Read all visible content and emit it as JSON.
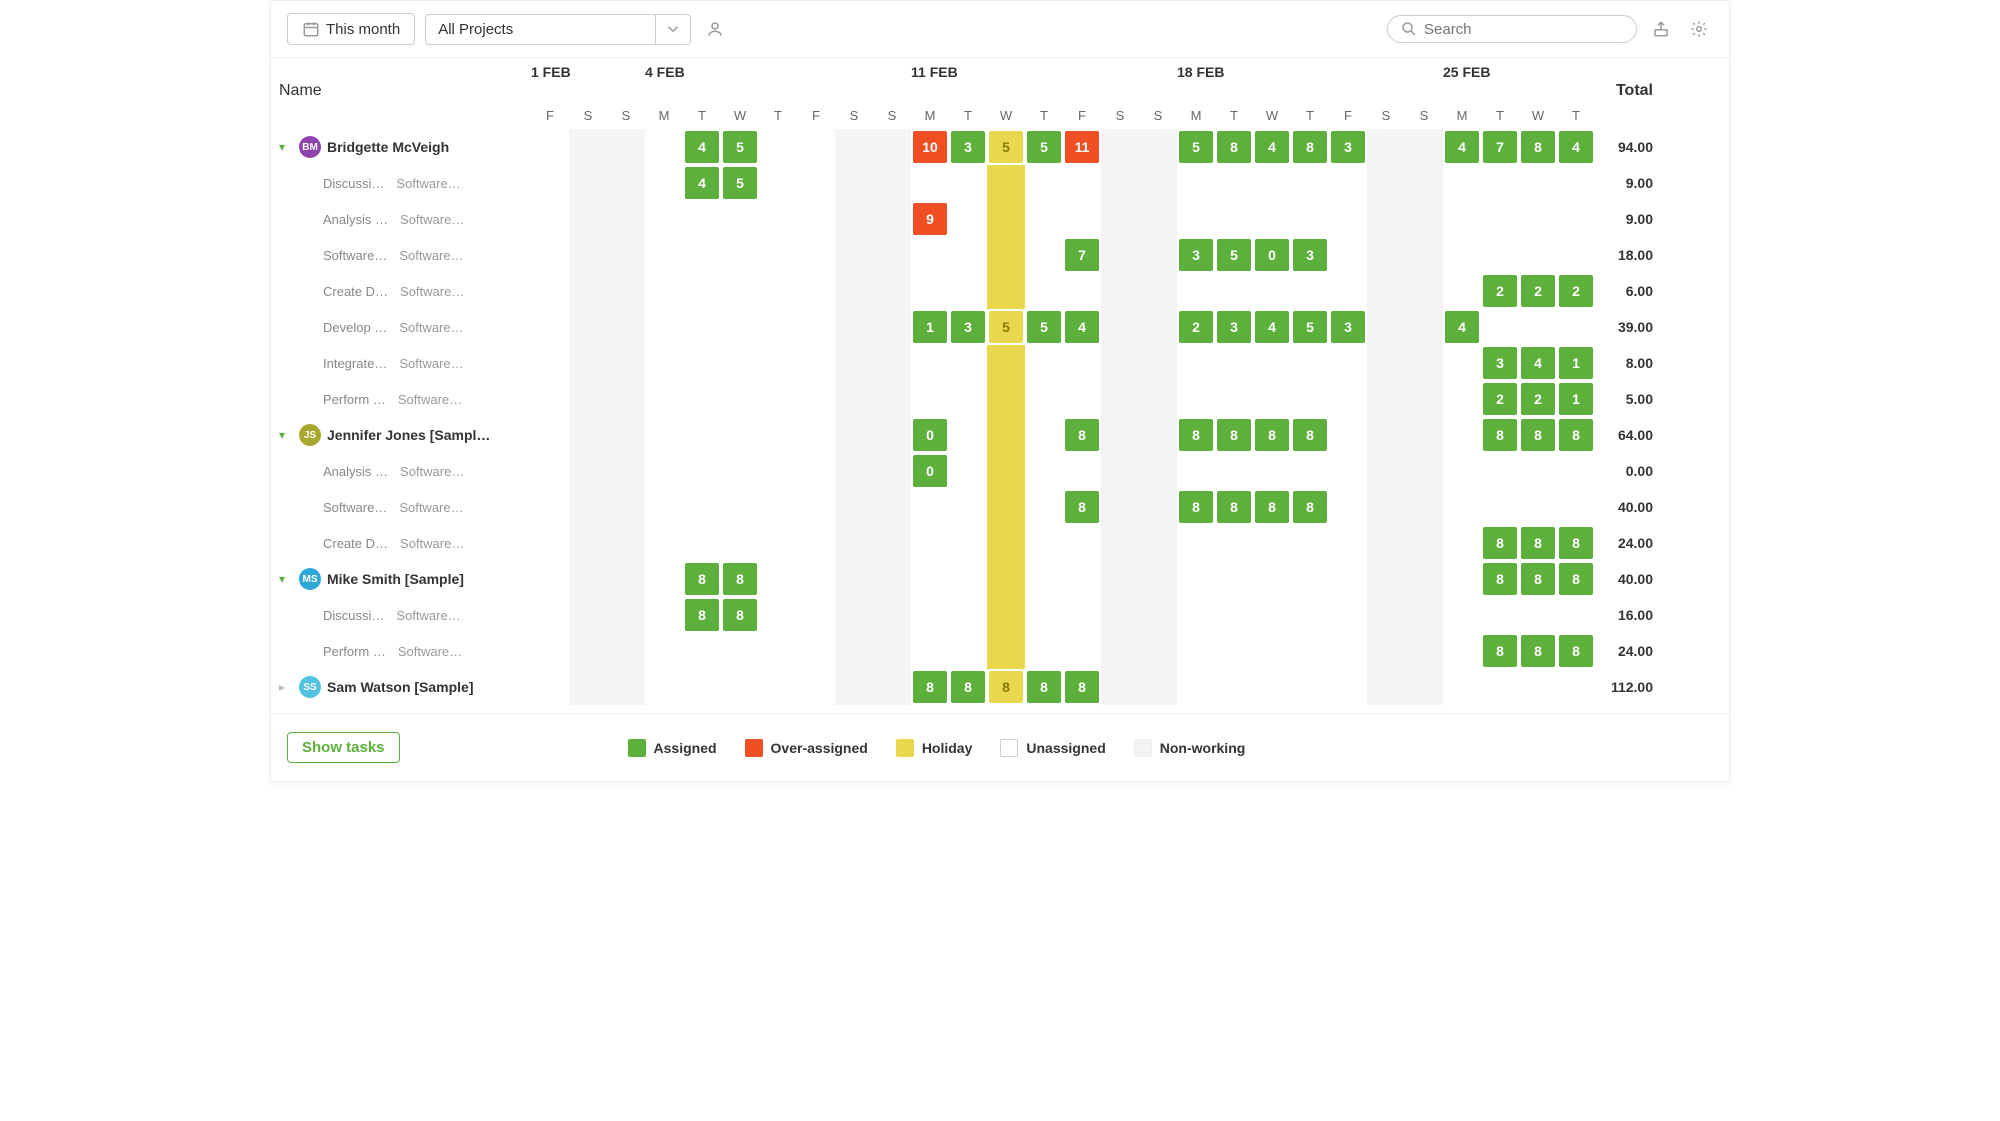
{
  "toolbar": {
    "range_label": "This month",
    "project_filter": "All Projects",
    "search_placeholder": "Search"
  },
  "headers": {
    "name": "Name",
    "total": "Total"
  },
  "columns": [
    {
      "day": "F",
      "month": null,
      "weekend": false
    },
    {
      "day": "S",
      "month": null,
      "weekend": true
    },
    {
      "day": "S",
      "month": null,
      "weekend": true
    },
    {
      "day": "M",
      "month": "1 FEB",
      "weekend": false
    },
    {
      "day": "T",
      "month": null,
      "weekend": false
    },
    {
      "day": "W",
      "month": null,
      "weekend": false
    },
    {
      "day": "T",
      "month": null,
      "weekend": false
    },
    {
      "day": "F",
      "month": null,
      "weekend": false
    },
    {
      "day": "S",
      "month": null,
      "weekend": true
    },
    {
      "day": "S",
      "month": null,
      "weekend": true
    },
    {
      "day": "M",
      "month": "4 FEB",
      "weekend": false
    },
    {
      "day": "T",
      "month": null,
      "weekend": false
    },
    {
      "day": "W",
      "month": "11 FEB",
      "holiday": true
    },
    {
      "day": "T",
      "month": null,
      "weekend": false
    },
    {
      "day": "F",
      "month": null,
      "weekend": false
    },
    {
      "day": "S",
      "month": null,
      "weekend": true
    },
    {
      "day": "S",
      "month": null,
      "weekend": true
    },
    {
      "day": "M",
      "month": null,
      "weekend": false
    },
    {
      "day": "T",
      "month": "18 FEB",
      "weekend": false
    },
    {
      "day": "W",
      "month": null,
      "weekend": false
    },
    {
      "day": "T",
      "month": null,
      "weekend": false
    },
    {
      "day": "F",
      "month": null,
      "weekend": false
    },
    {
      "day": "S",
      "month": null,
      "weekend": true
    },
    {
      "day": "S",
      "month": null,
      "weekend": true
    },
    {
      "day": "M",
      "month": null,
      "weekend": false
    },
    {
      "day": "T",
      "month": "25 FEB",
      "weekend": false
    },
    {
      "day": "W",
      "month": null,
      "weekend": false
    },
    {
      "day": "T",
      "month": null,
      "weekend": false
    }
  ],
  "month_labels": [
    {
      "col": 0,
      "text": "1 FEB"
    },
    {
      "col": 3,
      "text": "4 FEB"
    },
    {
      "col": 10,
      "text": "11 FEB"
    },
    {
      "col": 17,
      "text": "18 FEB"
    },
    {
      "col": 24,
      "text": "25 FEB"
    }
  ],
  "people": [
    {
      "name": "Bridgette McVeigh",
      "initials": "BM",
      "color": "#8e44ad",
      "expanded": true,
      "total": "94.00",
      "cells": {
        "4": {
          "v": "4",
          "t": "a"
        },
        "5": {
          "v": "5",
          "t": "a"
        },
        "10": {
          "v": "10",
          "t": "o"
        },
        "11": {
          "v": "3",
          "t": "a"
        },
        "12": {
          "v": "5",
          "t": "h"
        },
        "13": {
          "v": "5",
          "t": "a"
        },
        "14": {
          "v": "11",
          "t": "o"
        },
        "17": {
          "v": "5",
          "t": "a"
        },
        "18": {
          "v": "8",
          "t": "a"
        },
        "19": {
          "v": "4",
          "t": "a"
        },
        "20": {
          "v": "8",
          "t": "a"
        },
        "21": {
          "v": "3",
          "t": "a"
        },
        "24": {
          "v": "4",
          "t": "a"
        },
        "25": {
          "v": "7",
          "t": "a"
        },
        "26": {
          "v": "8",
          "t": "a"
        },
        "27": {
          "v": "4",
          "t": "a"
        }
      },
      "tasks": [
        {
          "task": "Discussi…",
          "project": "Software…",
          "total": "9.00",
          "cells": {
            "4": {
              "v": "4",
              "t": "a"
            },
            "5": {
              "v": "5",
              "t": "a"
            }
          }
        },
        {
          "task": "Analysis …",
          "project": "Software…",
          "total": "9.00",
          "cells": {
            "10": {
              "v": "9",
              "t": "o"
            }
          }
        },
        {
          "task": "Software…",
          "project": "Software…",
          "total": "18.00",
          "cells": {
            "14": {
              "v": "7",
              "t": "a"
            },
            "17": {
              "v": "3",
              "t": "a"
            },
            "18": {
              "v": "5",
              "t": "a"
            },
            "19": {
              "v": "0",
              "t": "a"
            },
            "20": {
              "v": "3",
              "t": "a"
            }
          }
        },
        {
          "task": "Create D…",
          "project": "Software…",
          "total": "6.00",
          "cells": {
            "25": {
              "v": "2",
              "t": "a"
            },
            "26": {
              "v": "2",
              "t": "a"
            },
            "27": {
              "v": "2",
              "t": "a"
            }
          }
        },
        {
          "task": "Develop …",
          "project": "Software…",
          "total": "39.00",
          "cells": {
            "10": {
              "v": "1",
              "t": "a"
            },
            "11": {
              "v": "3",
              "t": "a"
            },
            "12": {
              "v": "5",
              "t": "h"
            },
            "13": {
              "v": "5",
              "t": "a"
            },
            "14": {
              "v": "4",
              "t": "a"
            },
            "17": {
              "v": "2",
              "t": "a"
            },
            "18": {
              "v": "3",
              "t": "a"
            },
            "19": {
              "v": "4",
              "t": "a"
            },
            "20": {
              "v": "5",
              "t": "a"
            },
            "21": {
              "v": "3",
              "t": "a"
            },
            "24": {
              "v": "4",
              "t": "a"
            }
          }
        },
        {
          "task": "Integrate…",
          "project": "Software…",
          "total": "8.00",
          "cells": {
            "25": {
              "v": "3",
              "t": "a"
            },
            "26": {
              "v": "4",
              "t": "a"
            },
            "27": {
              "v": "1",
              "t": "a"
            }
          }
        },
        {
          "task": "Perform …",
          "project": "Software…",
          "total": "5.00",
          "cells": {
            "25": {
              "v": "2",
              "t": "a"
            },
            "26": {
              "v": "2",
              "t": "a"
            },
            "27": {
              "v": "1",
              "t": "a"
            }
          }
        }
      ]
    },
    {
      "name": "Jennifer Jones [Sampl…",
      "initials": "JS",
      "color": "#a8a82e",
      "expanded": true,
      "total": "64.00",
      "cells": {
        "10": {
          "v": "0",
          "t": "a"
        },
        "14": {
          "v": "8",
          "t": "a"
        },
        "17": {
          "v": "8",
          "t": "a"
        },
        "18": {
          "v": "8",
          "t": "a"
        },
        "19": {
          "v": "8",
          "t": "a"
        },
        "20": {
          "v": "8",
          "t": "a"
        },
        "25": {
          "v": "8",
          "t": "a"
        },
        "26": {
          "v": "8",
          "t": "a"
        },
        "27": {
          "v": "8",
          "t": "a"
        }
      },
      "tasks": [
        {
          "task": "Analysis …",
          "project": "Software…",
          "total": "0.00",
          "cells": {
            "10": {
              "v": "0",
              "t": "a"
            }
          }
        },
        {
          "task": "Software…",
          "project": "Software…",
          "total": "40.00",
          "cells": {
            "14": {
              "v": "8",
              "t": "a"
            },
            "17": {
              "v": "8",
              "t": "a"
            },
            "18": {
              "v": "8",
              "t": "a"
            },
            "19": {
              "v": "8",
              "t": "a"
            },
            "20": {
              "v": "8",
              "t": "a"
            }
          }
        },
        {
          "task": "Create D…",
          "project": "Software…",
          "total": "24.00",
          "cells": {
            "25": {
              "v": "8",
              "t": "a"
            },
            "26": {
              "v": "8",
              "t": "a"
            },
            "27": {
              "v": "8",
              "t": "a"
            }
          }
        }
      ]
    },
    {
      "name": "Mike Smith [Sample]",
      "initials": "MS",
      "color": "#2ea8d8",
      "expanded": true,
      "total": "40.00",
      "cells": {
        "4": {
          "v": "8",
          "t": "a"
        },
        "5": {
          "v": "8",
          "t": "a"
        },
        "25": {
          "v": "8",
          "t": "a"
        },
        "26": {
          "v": "8",
          "t": "a"
        },
        "27": {
          "v": "8",
          "t": "a"
        }
      },
      "tasks": [
        {
          "task": "Discussi…",
          "project": "Software…",
          "total": "16.00",
          "cells": {
            "4": {
              "v": "8",
              "t": "a"
            },
            "5": {
              "v": "8",
              "t": "a"
            }
          }
        },
        {
          "task": "Perform …",
          "project": "Software…",
          "total": "24.00",
          "cells": {
            "25": {
              "v": "8",
              "t": "a"
            },
            "26": {
              "v": "8",
              "t": "a"
            },
            "27": {
              "v": "8",
              "t": "a"
            }
          }
        }
      ]
    },
    {
      "name": "Sam Watson [Sample]",
      "initials": "SS",
      "color": "#4fc3e0",
      "expanded": false,
      "total": "112.00",
      "cells": {
        "10": {
          "v": "8",
          "t": "a"
        },
        "11": {
          "v": "8",
          "t": "a"
        },
        "12": {
          "v": "8",
          "t": "h"
        },
        "13": {
          "v": "8",
          "t": "a"
        },
        "14": {
          "v": "8",
          "t": "a"
        }
      },
      "tasks": []
    }
  ],
  "footer": {
    "show_tasks": "Show tasks"
  },
  "legend": {
    "assigned": "Assigned",
    "over": "Over-assigned",
    "holiday": "Holiday",
    "unassigned": "Unassigned",
    "nonworking": "Non-working"
  }
}
